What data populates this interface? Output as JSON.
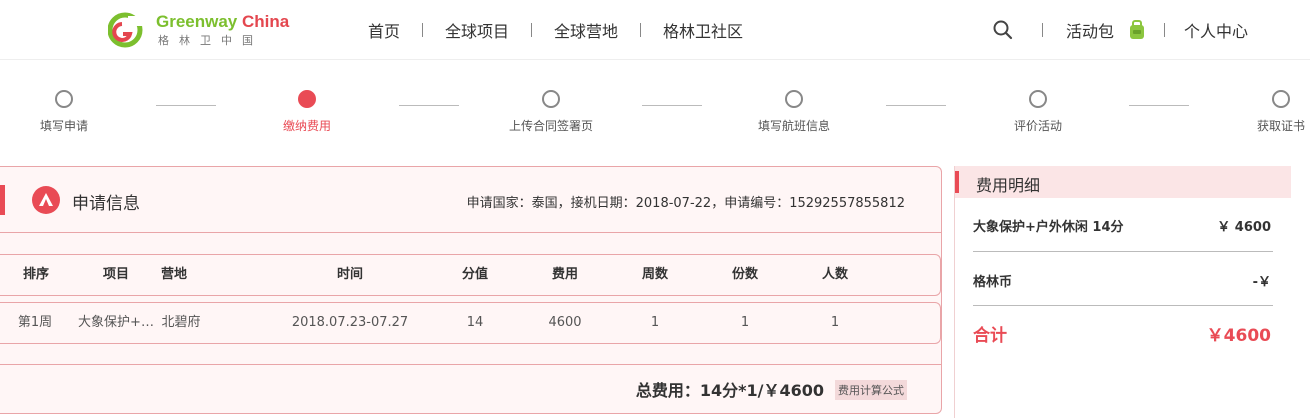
{
  "logo": {
    "en_green": "Greenway",
    "en_red": "China",
    "cn": "格林卫中国"
  },
  "nav": {
    "items": [
      "首页",
      "全球项目",
      "全球营地",
      "格林卫社区"
    ]
  },
  "header_right": {
    "events_label": "活动包",
    "user_center_label": "个人中心"
  },
  "steps": [
    {
      "label": "填写申请",
      "active": false
    },
    {
      "label": "缴纳费用",
      "active": true
    },
    {
      "label": "上传合同签署页",
      "active": false
    },
    {
      "label": "填写航班信息",
      "active": false
    },
    {
      "label": "评价活动",
      "active": false
    },
    {
      "label": "获取证书",
      "active": false
    }
  ],
  "application": {
    "title": "申请信息",
    "info": "申请国家：泰国，接机日期：2018-07-22，申请编号：15292557855812"
  },
  "table": {
    "headers": [
      "排序",
      "项目",
      "营地",
      "时间",
      "分值",
      "费用",
      "周数",
      "份数",
      "人数"
    ],
    "rows": [
      [
        "第1周",
        "大象保护+…",
        "北碧府",
        "2018.07.23-07.27",
        "14",
        "4600",
        "1",
        "1",
        "1"
      ]
    ]
  },
  "footer": {
    "total": "总费用：14分*1/￥4600",
    "formula_label": "费用计算公式"
  },
  "fee_detail": {
    "title": "费用明细",
    "rows": [
      {
        "label": "大象保护+户外休闲 14分",
        "value": "￥ 4600"
      },
      {
        "label": "格林币",
        "value": "-￥"
      }
    ],
    "total_label": "合计",
    "total_value": "￥4600"
  },
  "colors": {
    "accent": "#e94b55",
    "brand_green": "#7cbf2e",
    "panel_bg": "#fff6f6",
    "panel_border": "#e9a5a8"
  },
  "icons": [
    "search-icon",
    "bag-icon",
    "tent-icon"
  ]
}
